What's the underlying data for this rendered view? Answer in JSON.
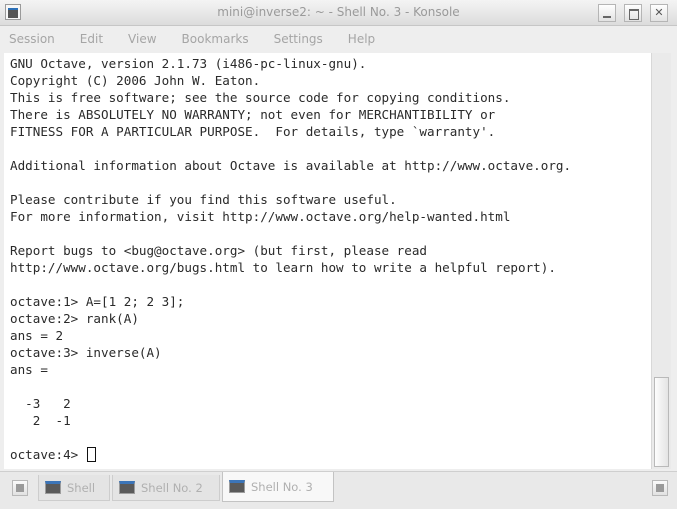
{
  "window": {
    "title": "mini@inverse2: ~ - Shell No. 3 - Konsole"
  },
  "menu": {
    "items": [
      "Session",
      "Edit",
      "View",
      "Bookmarks",
      "Settings",
      "Help"
    ]
  },
  "terminal": {
    "lines": [
      "GNU Octave, version 2.1.73 (i486-pc-linux-gnu).",
      "Copyright (C) 2006 John W. Eaton.",
      "This is free software; see the source code for copying conditions.",
      "There is ABSOLUTELY NO WARRANTY; not even for MERCHANTIBILITY or",
      "FITNESS FOR A PARTICULAR PURPOSE.  For details, type `warranty'.",
      "",
      "Additional information about Octave is available at http://www.octave.org.",
      "",
      "Please contribute if you find this software useful.",
      "For more information, visit http://www.octave.org/help-wanted.html",
      "",
      "Report bugs to <bug@octave.org> (but first, please read",
      "http://www.octave.org/bugs.html to learn how to write a helpful report).",
      "",
      "octave:1> A=[1 2; 2 3];",
      "octave:2> rank(A)",
      "ans = 2",
      "octave:3> inverse(A)",
      "ans =",
      "",
      "  -3   2",
      "   2  -1",
      "",
      "octave:4> "
    ]
  },
  "tabs": [
    {
      "label": "Shell",
      "icon": "terminal-icon"
    },
    {
      "label": "Shell No. 2",
      "icon": "terminal-icon"
    },
    {
      "label": "Shell No. 3",
      "icon": "terminal-icon",
      "active": true
    }
  ]
}
